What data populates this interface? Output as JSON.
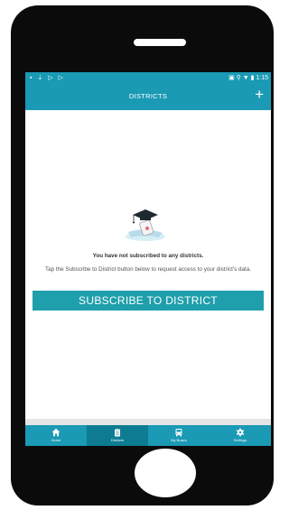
{
  "status_bar": {
    "left_icons": "▪ ⇣ ▷ ▷",
    "right_icons": "▣ ⚲ ▼ ▮",
    "time": "1:15"
  },
  "header": {
    "title": "DISTRICTS",
    "add_label": "+"
  },
  "empty_state": {
    "icon": "graduation-cap-on-diploma",
    "title": "You have not subscribed to any districts.",
    "body": "Tap the Subscribe to District button below to request access to your district's data."
  },
  "subscribe_button": {
    "label": "SUBSCRIBE TO DISTRICT"
  },
  "bottom_nav": {
    "items": [
      {
        "label": "Home",
        "icon": "home-icon",
        "active": false
      },
      {
        "label": "Districts",
        "icon": "clipboard-icon",
        "active": true
      },
      {
        "label": "My Buses",
        "icon": "bus-icon",
        "active": false
      },
      {
        "label": "Settings",
        "icon": "gear-icon",
        "active": false
      }
    ]
  },
  "colors": {
    "primary": "#1a9ab5",
    "button": "#1e9fab",
    "nav_active": "#0d7c92"
  }
}
